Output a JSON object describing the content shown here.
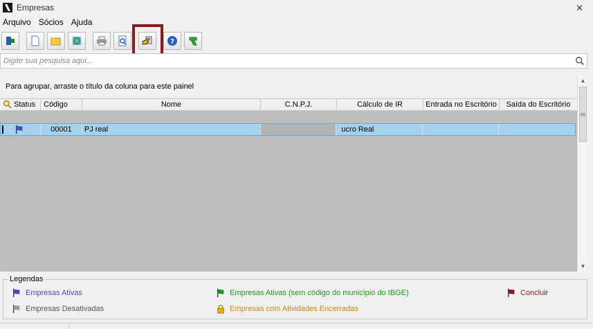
{
  "window": {
    "title": "Empresas",
    "close_glyph": "✕"
  },
  "menu": [
    {
      "label": "Arquivo"
    },
    {
      "label": "Sócios"
    },
    {
      "label": "Ajuda"
    }
  ],
  "toolbar": {
    "buttons": [
      {
        "icon": "exit-icon"
      },
      {
        "icon": "new-document-icon"
      },
      {
        "icon": "open-folder-icon"
      },
      {
        "icon": "refresh-icon"
      },
      {
        "icon": "printer-icon"
      },
      {
        "icon": "print-preview-icon"
      },
      {
        "icon": "company-select-icon"
      },
      {
        "icon": "help-icon"
      },
      {
        "icon": "return-arrow-icon"
      }
    ]
  },
  "search": {
    "placeholder": "Digite sua pesquisa aqui...",
    "value": ""
  },
  "group_panel": {
    "text": "Para agrupar, arraste o título da coluna para este painel"
  },
  "grid": {
    "columns": [
      {
        "label": "Status"
      },
      {
        "label": "Código"
      },
      {
        "label": "Nome"
      },
      {
        "label": "C.N.P.J."
      },
      {
        "label": "Cálculo de IR"
      },
      {
        "label": "Entrada no Escritório"
      },
      {
        "label": "Saída do Escritório"
      }
    ],
    "sort_indicator": "/",
    "rows": [
      {
        "status": "active",
        "codigo": "00001",
        "nome": "PJ real",
        "cnpj": "",
        "calculo_ir": "ucro Real",
        "entrada": "",
        "saida": ""
      }
    ]
  },
  "legend": {
    "title": "Legendas",
    "items": [
      {
        "label": "Empresas Ativas",
        "color": "#4a4ab8"
      },
      {
        "label": "Empresas Desativadas",
        "color": "#555555"
      },
      {
        "label": "Empresas Ativas (sem código do município do IBGE)",
        "color": "#1a9a1a"
      },
      {
        "label": "Empresas com Atividades Encerradas",
        "color": "#c78a00"
      },
      {
        "label": "Concluir",
        "color": "#8b1a1a"
      }
    ]
  },
  "colors": {
    "selection": "#a6d2ee",
    "grid_background": "#bdbdbd",
    "highlight_box": "#8b1a1a"
  }
}
